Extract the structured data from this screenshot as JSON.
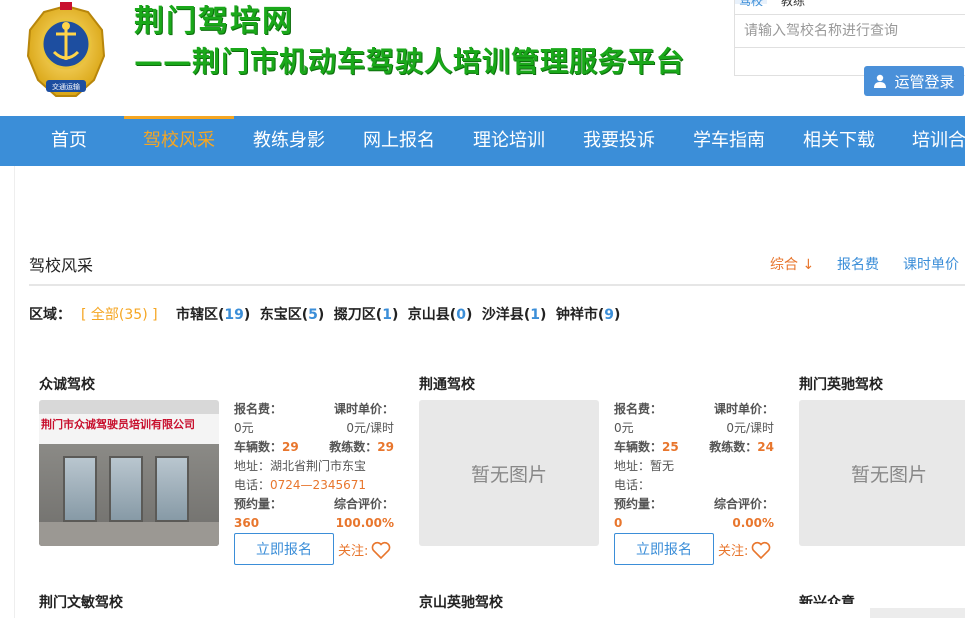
{
  "header": {
    "title": "荆门驾培网",
    "subtitle": "——荆门市机动车驾驶人培训管理服务平台",
    "emblem_text": "交通运输"
  },
  "search": {
    "tabs": [
      "驾校",
      "教练"
    ],
    "placeholder": "请输入驾校名称进行查询",
    "login_label": "运管登录"
  },
  "nav": {
    "items": [
      "首页",
      "驾校风采",
      "教练身影",
      "网上报名",
      "理论培训",
      "我要投诉",
      "学车指南",
      "相关下载",
      "培训合"
    ],
    "active_index": 1
  },
  "section": {
    "title": "驾校风采",
    "sorts": [
      {
        "label": "综合 ↓",
        "active": true
      },
      {
        "label": "报名费",
        "active": false
      },
      {
        "label": "课时单价",
        "active": false
      }
    ]
  },
  "regions": {
    "label": "区域：",
    "all": "[ 全部(35) ]",
    "items": [
      {
        "name": "市辖区",
        "count": "19"
      },
      {
        "name": "东宝区",
        "count": "5"
      },
      {
        "name": "掇刀区",
        "count": "1"
      },
      {
        "name": "京山县",
        "count": "0"
      },
      {
        "name": "沙洋县",
        "count": "1"
      },
      {
        "name": "钟祥市",
        "count": "9"
      }
    ]
  },
  "labels": {
    "fee": "报名费：",
    "unit_price": "课时单价：",
    "vehicles": "车辆数：",
    "coaches": "教练数：",
    "address": "地址：",
    "phone": "电话：",
    "bookings": "预约量：",
    "rating": "综合评价：",
    "enroll": "立即报名",
    "follow": "关注:",
    "no_image": "暂无图片"
  },
  "schools": [
    {
      "name": "众诚驾校",
      "fee": "0元",
      "unit_price": "0元/课时",
      "vehicles": "29",
      "coaches": "29",
      "address": "湖北省荆门市东宝",
      "phone": "0724—2345671",
      "bookings": "360",
      "rating": "100.00%",
      "photo_sign": "荆门市众诚驾驶员培训有限公司"
    },
    {
      "name": "荆通驾校",
      "fee": "0元",
      "unit_price": "0元/课时",
      "vehicles": "25",
      "coaches": "24",
      "address": "暂无",
      "phone": "",
      "bookings": "0",
      "rating": "0.00%"
    },
    {
      "name": "荆门英驰驾校"
    },
    {
      "name": "荆门文敏驾校"
    },
    {
      "name": "京山英驰驾校"
    },
    {
      "name": "新兴众意"
    }
  ],
  "colors": {
    "nav_bg": "#3b8ed8",
    "accent_orange": "#f5a623",
    "title_green": "#1aa81a",
    "value_orange": "#e8762d"
  }
}
